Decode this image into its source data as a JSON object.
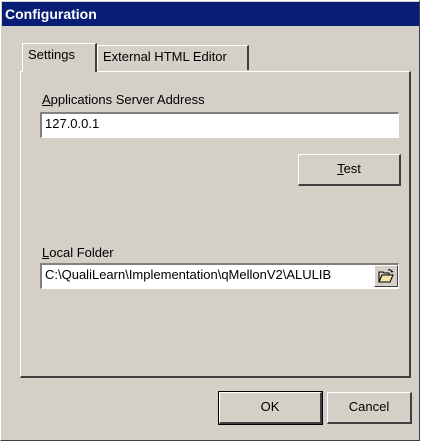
{
  "window": {
    "title": "Configuration"
  },
  "tabs": [
    {
      "label": "Settings",
      "active": true
    },
    {
      "label": "External HTML Editor",
      "active": false
    }
  ],
  "settings": {
    "server_label_first": "A",
    "server_label_rest": "pplications Server Address",
    "server_value": "127.0.0.1",
    "test_first": "T",
    "test_rest": "est",
    "folder_label_first": "L",
    "folder_label_rest": "ocal Folder",
    "folder_value": "C:\\QualiLearn\\Implementation\\qMellonV2\\ALULIB",
    "browse_icon": "open-folder-icon"
  },
  "buttons": {
    "ok": "OK",
    "cancel": "Cancel"
  },
  "colors": {
    "titlebar": "#081d75",
    "dialog": "#d4d0c8"
  }
}
